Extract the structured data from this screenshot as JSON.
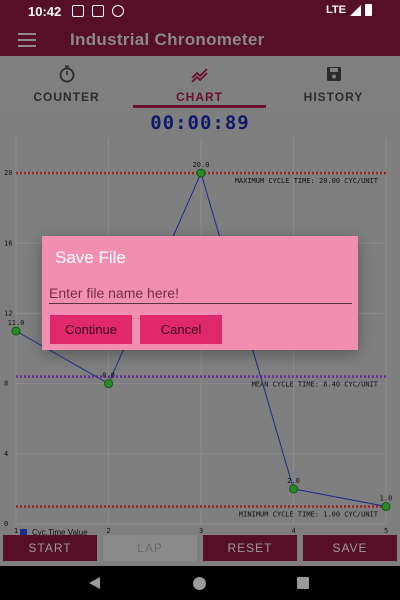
{
  "status_bar": {
    "time": "10:42",
    "network": "LTE"
  },
  "app_bar": {
    "title": "Industrial Chronometer",
    "menu_icon": "hamburger-menu-icon"
  },
  "tabs": [
    {
      "label": "COUNTER",
      "icon": "stopwatch-icon",
      "active": false
    },
    {
      "label": "CHART",
      "icon": "trend-chart-icon",
      "active": true
    },
    {
      "label": "HISTORY",
      "icon": "save-disk-icon",
      "active": false
    }
  ],
  "timer": "00:00:89",
  "chart_data": {
    "type": "line",
    "x": [
      1,
      2,
      3,
      4,
      5
    ],
    "series": [
      {
        "name": "Cyc.Time Value",
        "values": [
          11.0,
          8.0,
          20.0,
          2.0,
          1.0
        ],
        "color": "#1e2a8c"
      }
    ],
    "point_labels": [
      "11.0",
      "8.0",
      "20.0",
      "2.0",
      "1.0"
    ],
    "xticks": [
      "1",
      "2",
      "3",
      "4",
      "5"
    ],
    "yticks": [
      "0",
      "4",
      "8",
      "12",
      "16",
      "20"
    ],
    "ylim": [
      0,
      22
    ],
    "reference_lines": [
      {
        "label": "MAXIMUM CYCLE TIME: 20.00 CYC/UNIT",
        "value": 20.0,
        "color": "#a02020"
      },
      {
        "label": "MEAN CYCLE TIME: 8.40 CYC/UNIT",
        "value": 8.4,
        "color": "#6a2aa0"
      },
      {
        "label": "MINIMUM CYCLE TIME: 1.00 CYC/UNIT",
        "value": 1.0,
        "color": "#a02020"
      }
    ],
    "grid": true,
    "legend_position": "bottom-left"
  },
  "buttons": {
    "start": "START",
    "lap": "LAP",
    "reset": "RESET",
    "save": "SAVE"
  },
  "dialog": {
    "title": "Save File",
    "input_placeholder": "Enter file name here!",
    "input_value": "",
    "continue_label": "Continue",
    "cancel_label": "Cancel"
  },
  "colors": {
    "primary": "#570f28",
    "accent": "#e0286a",
    "dialog_bg": "#f28fb0",
    "timer": "#0d1a6b"
  }
}
